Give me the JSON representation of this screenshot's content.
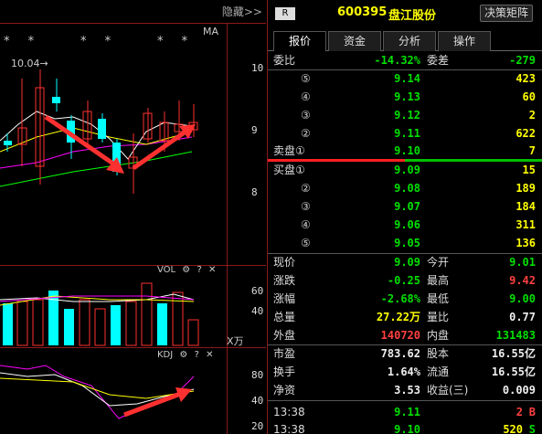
{
  "left": {
    "hide_label": "隐藏>>",
    "ma_label": "MA",
    "stars": [
      "* *",
      "* *",
      "* *"
    ],
    "high_marker": "10.04→",
    "price_ticks": [
      "10",
      "9",
      "8"
    ],
    "vol_header": "VOL",
    "vol_ticks": [
      "60",
      "40"
    ],
    "vol_unit": "X万",
    "kdj_header": "KDJ",
    "kdj_ticks": [
      "80",
      "40",
      "20"
    ],
    "gear_icon": "⚙",
    "help_icon": "?",
    "close_icon": "✕",
    "colors": {
      "up": "#ff3030",
      "down": "#00ffff",
      "ma5": "#ffffff",
      "ma10": "#ffff00",
      "ma20": "#ff00ff",
      "ma60": "#00ff00",
      "arrow": "#ff3030"
    }
  },
  "header": {
    "badge": "R",
    "code": "600395",
    "name": "盘江股份",
    "decision_button": "决策矩阵"
  },
  "tabs": [
    {
      "label": "报价",
      "active": true
    },
    {
      "label": "资金",
      "active": false
    },
    {
      "label": "分析",
      "active": false
    },
    {
      "label": "操作",
      "active": false
    }
  ],
  "weibi": {
    "label": "委比",
    "value": "-14.32%",
    "label2": "委差",
    "value2": "-279"
  },
  "asks": [
    {
      "idx": "⑤",
      "price": "9.14",
      "vol": "423"
    },
    {
      "idx": "④",
      "price": "9.13",
      "vol": "60"
    },
    {
      "idx": "③",
      "price": "9.12",
      "vol": "2"
    },
    {
      "idx": "②",
      "price": "9.11",
      "vol": "622"
    },
    {
      "idx": "卖盘①",
      "price": "9.10",
      "vol": "7"
    }
  ],
  "bids": [
    {
      "idx": "买盘①",
      "price": "9.09",
      "vol": "15"
    },
    {
      "idx": "②",
      "price": "9.08",
      "vol": "189"
    },
    {
      "idx": "③",
      "price": "9.07",
      "vol": "184"
    },
    {
      "idx": "④",
      "price": "9.06",
      "vol": "311"
    },
    {
      "idx": "⑤",
      "price": "9.05",
      "vol": "136"
    }
  ],
  "stats1": [
    {
      "l1": "现价",
      "v1": "9.09",
      "c1": "green",
      "l2": "今开",
      "v2": "9.01",
      "c2": "green"
    },
    {
      "l1": "涨跌",
      "v1": "-0.25",
      "c1": "green",
      "l2": "最高",
      "v2": "9.42",
      "c2": "red"
    },
    {
      "l1": "涨幅",
      "v1": "-2.68%",
      "c1": "green",
      "l2": "最低",
      "v2": "9.00",
      "c2": "green"
    },
    {
      "l1": "总量",
      "v1": "27.22万",
      "c1": "yellow",
      "l2": "量比",
      "v2": "0.77",
      "c2": "white"
    },
    {
      "l1": "外盘",
      "v1": "140720",
      "c1": "red",
      "l2": "内盘",
      "v2": "131483",
      "c2": "green"
    }
  ],
  "stats2": [
    {
      "l1": "市盈",
      "v1": "783.62",
      "c1": "white",
      "l2": "股本",
      "v2": "16.55亿",
      "c2": "white"
    },
    {
      "l1": "换手",
      "v1": "1.64%",
      "c1": "white",
      "l2": "流通",
      "v2": "16.55亿",
      "c2": "white"
    },
    {
      "l1": "净资",
      "v1": "3.53",
      "c1": "white",
      "l2": "收益(三)",
      "v2": "0.009",
      "c2": "white"
    }
  ],
  "ticks": [
    {
      "time": "13:38",
      "price": "9.11",
      "vol": "2",
      "side": "B",
      "side_color": "red"
    },
    {
      "time": "13:38",
      "price": "9.10",
      "vol": "520",
      "side": "S",
      "side_color": "green"
    }
  ]
}
